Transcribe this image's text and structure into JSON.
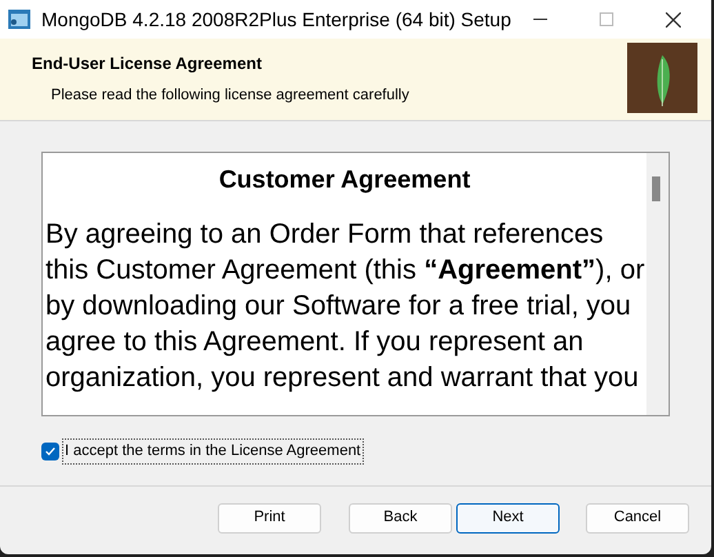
{
  "window": {
    "title": "MongoDB 4.2.18 2008R2Plus Enterprise (64 bit) Setup"
  },
  "header": {
    "title": "End-User License Agreement",
    "subtitle": "Please read the following license agreement carefully"
  },
  "license": {
    "heading": "Customer Agreement",
    "text": "By agreeing to an Order Form that references this Customer Agreement (this **“Agreement”**), or by downloading our Software for a free trial, you agree to this Agreement. If you represent an organization, you represent and warrant that you"
  },
  "accept": {
    "label": "I accept the terms in the License Agreement",
    "checked": true
  },
  "buttons": [
    {
      "label": "Print",
      "default": false
    },
    {
      "label": "Back",
      "default": false
    },
    {
      "label": "Next",
      "default": true
    },
    {
      "label": "Cancel",
      "default": false
    }
  ]
}
